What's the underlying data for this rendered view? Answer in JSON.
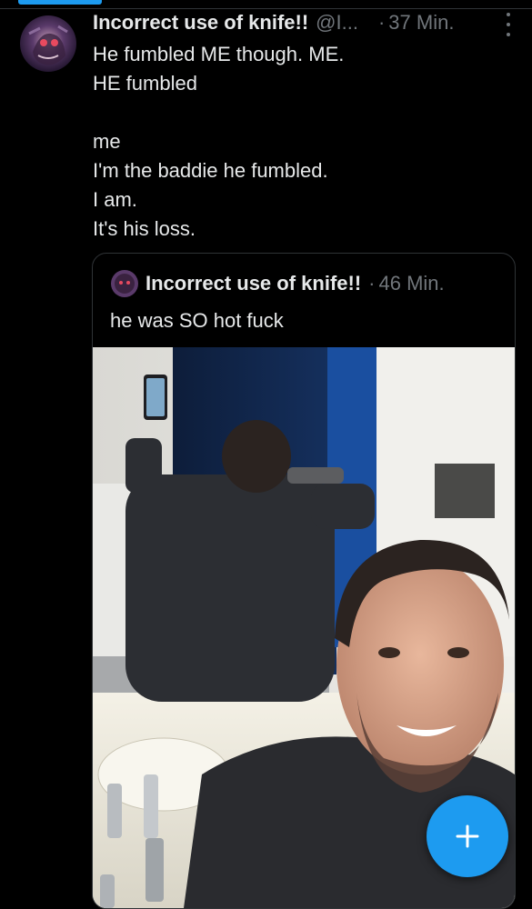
{
  "tweet": {
    "author_name": "Incorrect use of knife!!",
    "handle": "@I...",
    "separator": "·",
    "time": "37 Min.",
    "lines": [
      "He fumbled ME though. ME.",
      "HE fumbled",
      "me",
      "I'm the baddie he fumbled.",
      "I am.",
      "It's his loss."
    ]
  },
  "quoted_tweet": {
    "author_name": "Incorrect use of knife!!",
    "separator": "·",
    "time": "46 Min.",
    "text": "he was SO hot fuck",
    "image_alt": "photo"
  },
  "colors": {
    "accent": "#1d9bf0",
    "background": "#000000",
    "text": "#e7e9ea",
    "muted": "#71767b",
    "border": "#2f3336"
  },
  "icons": {
    "more": "more-vertical-icon",
    "compose": "plus-icon"
  }
}
